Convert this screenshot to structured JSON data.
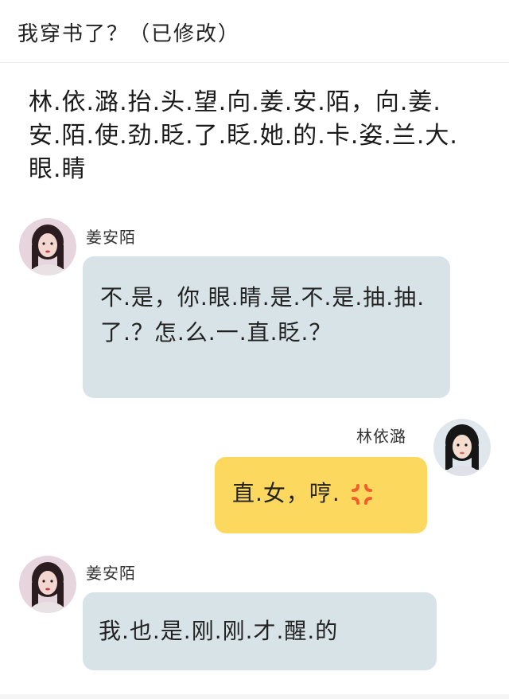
{
  "header": {
    "title": "我穿书了？（已修改）"
  },
  "narration": "林.依.潞.抬.头.望.向.姜.安.陌，向.姜.安.陌.使.劲.眨.了.眨.她.的.卡.姿.兰.大.眼.睛",
  "messages": [
    {
      "sender": "姜安陌",
      "text": "不.是，你.眼.睛.是.不.是.抽.抽.了.？怎.么.一.直.眨.？",
      "side": "left",
      "avatar_icon": "girl-avatar-icon",
      "bubble_color": "#d8e3e8"
    },
    {
      "sender": "林依潞",
      "text": "直.女，哼.",
      "side": "right",
      "avatar_icon": "girl-avatar-icon",
      "bubble_color": "#fcd85f",
      "emoji": "anger-icon"
    },
    {
      "sender": "姜安陌",
      "text": "我.也.是.刚.刚.才.醒.的",
      "side": "left",
      "avatar_icon": "girl-avatar-icon",
      "bubble_color": "#d8e3e8"
    }
  ]
}
